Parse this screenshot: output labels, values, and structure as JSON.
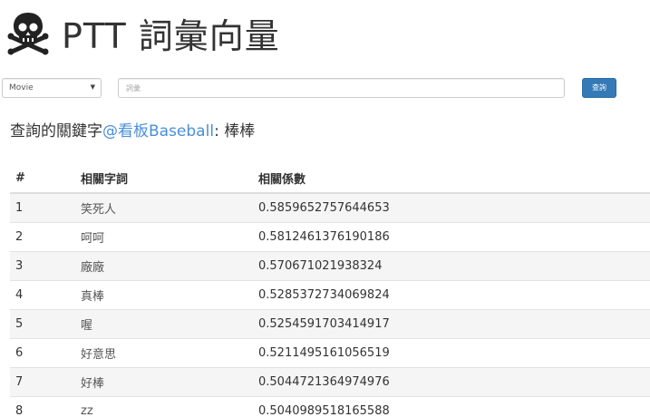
{
  "header": {
    "title": "PTT 詞彙向量"
  },
  "search": {
    "board_selected": "Movie",
    "keyword_placeholder": "詞彙",
    "button_label": "查詢"
  },
  "query": {
    "prefix": "查詢的關鍵字",
    "board_link": "@看板Baseball",
    "separator": ": ",
    "keyword": "棒棒"
  },
  "table": {
    "headers": [
      "#",
      "相關字詞",
      "相關係數"
    ],
    "rows": [
      {
        "rank": "1",
        "word": "笑死人",
        "score": "0.5859652757644653"
      },
      {
        "rank": "2",
        "word": "呵呵",
        "score": "0.5812461376190186"
      },
      {
        "rank": "3",
        "word": "廠廠",
        "score": "0.570671021938324"
      },
      {
        "rank": "4",
        "word": "真棒",
        "score": "0.5285372734069824"
      },
      {
        "rank": "5",
        "word": "喔",
        "score": "0.5254591703414917"
      },
      {
        "rank": "6",
        "word": "好意思",
        "score": "0.5211495161056519"
      },
      {
        "rank": "7",
        "word": "好棒",
        "score": "0.5044721364974976"
      },
      {
        "rank": "8",
        "word": "zz",
        "score": "0.5040989518165588"
      }
    ]
  }
}
